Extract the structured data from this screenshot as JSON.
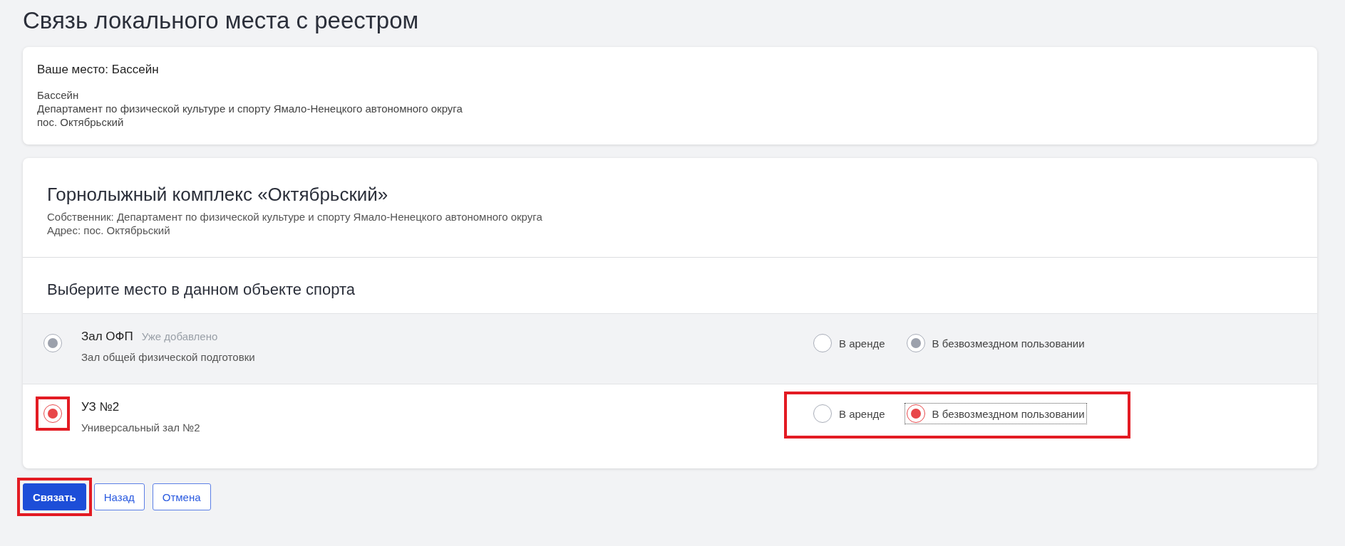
{
  "page_title": "Связь локального места с реестром",
  "local_place": {
    "heading": "Ваше место: Бассейн",
    "lines": [
      "Бассейн",
      "Департамент по физической культуре и спорту Ямало-Ненецкого автономного округа",
      "пос. Октябрьский"
    ]
  },
  "object": {
    "title": "Горнолыжный комплекс «Октябрьский»",
    "owner": "Собственник: Департамент по физической культуре и спорту Ямало-Ненецкого автономного округа",
    "address": "Адрес: пос. Октябрьский"
  },
  "choose_heading": "Выберите место в данном объекте спорта",
  "places": [
    {
      "name": "Зал ОФП",
      "badge": "Уже добавлено",
      "description": "Зал общей физической подготовки",
      "disabled": true,
      "selected": true,
      "highlighted": false,
      "options_highlighted": false,
      "options": [
        {
          "label": "В аренде",
          "selected": false,
          "focused": false
        },
        {
          "label": "В безвозмездном пользовании",
          "selected": true,
          "focused": false
        }
      ]
    },
    {
      "name": "УЗ №2",
      "description": "Универсальный зал №2",
      "disabled": false,
      "selected": true,
      "highlighted": true,
      "options_highlighted": true,
      "options": [
        {
          "label": "В аренде",
          "selected": false,
          "focused": false
        },
        {
          "label": "В безвозмездном пользовании",
          "selected": true,
          "focused": true
        }
      ]
    }
  ],
  "buttons": [
    {
      "label": "Связать",
      "kind": "primary",
      "highlighted": true
    },
    {
      "label": "Назад",
      "kind": "outline",
      "highlighted": false
    },
    {
      "label": "Отмена",
      "kind": "outline",
      "highlighted": false
    }
  ]
}
